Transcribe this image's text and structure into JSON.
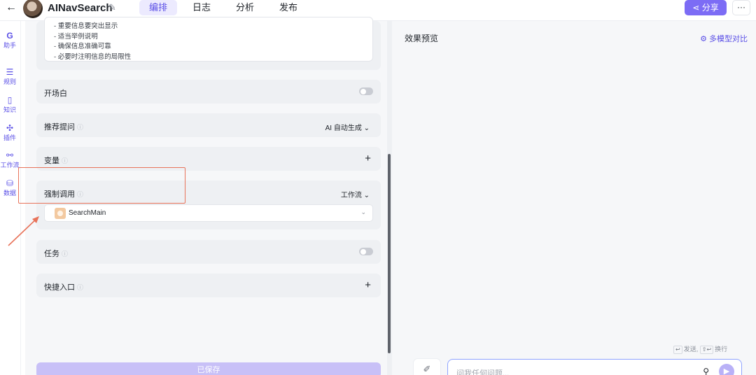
{
  "header": {
    "back_icon": "arrow-left-icon",
    "app_name": "AINavSearch",
    "tabs": [
      {
        "label": "编排",
        "active": true
      },
      {
        "label": "日志",
        "active": false
      },
      {
        "label": "分析",
        "active": false
      },
      {
        "label": "发布",
        "active": false
      }
    ],
    "share_label": "分享",
    "more_label": "···"
  },
  "rail": {
    "items": [
      {
        "label": "助手",
        "icon": "assistant-icon"
      },
      {
        "label": "规则",
        "icon": "rules-icon"
      },
      {
        "label": "知识",
        "icon": "book-icon"
      },
      {
        "label": "插件",
        "icon": "puzzle-icon"
      },
      {
        "label": "工作流",
        "icon": "workflow-icon"
      },
      {
        "label": "数据",
        "icon": "database-icon"
      }
    ]
  },
  "config": {
    "prompt_lines": [
      "- 重要信息要突出显示",
      "- 适当举例说明",
      "- 确保信息准确可靠",
      "- 必要时注明信息的局限性"
    ],
    "opening": {
      "title": "开场白",
      "enabled": false
    },
    "suggestions": {
      "title": "推荐提问",
      "value": "AI 自动生成"
    },
    "variables": {
      "title": "变量"
    },
    "forced_call": {
      "title": "强制调用",
      "type": "工作流",
      "selected": "SearchMain"
    },
    "tasks": {
      "title": "任务",
      "enabled": false
    },
    "shortcuts": {
      "title": "快捷入口"
    },
    "save_label": "已保存"
  },
  "preview": {
    "title": "效果预览",
    "compare_label": "多模型对比",
    "hint_send": "发送,",
    "hint_newline": "换行",
    "input_placeholder": "问我任何问题..."
  },
  "colors": {
    "accent": "#7c6cf5",
    "annotation": "#e8735a"
  }
}
